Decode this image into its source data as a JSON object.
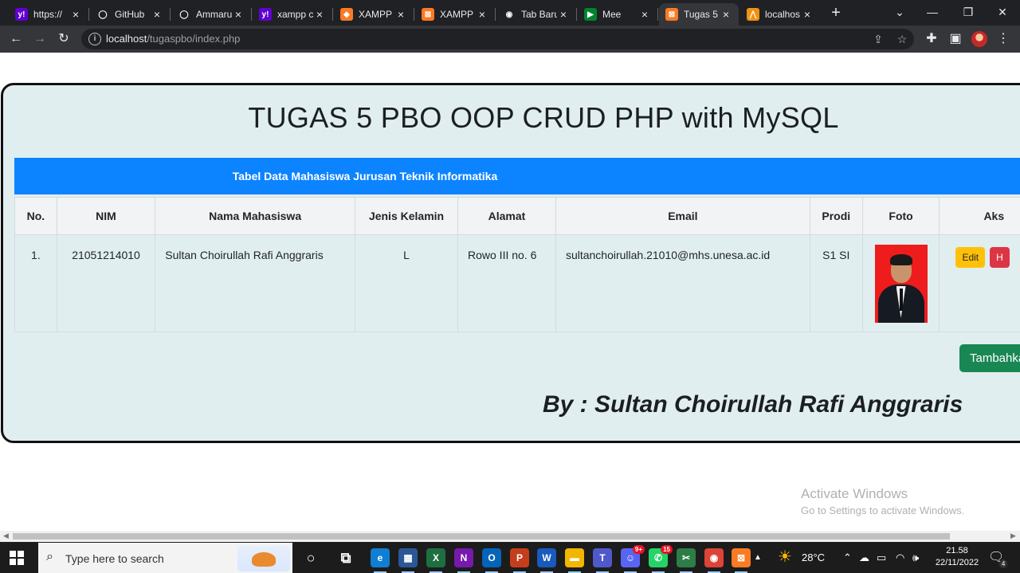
{
  "browser": {
    "tabs": [
      {
        "label": "https://",
        "icon": "yahoo-icon",
        "color": "#6001d2",
        "glyph": "y!"
      },
      {
        "label": "GitHub",
        "icon": "github-icon",
        "color": "#202124",
        "glyph": "◯"
      },
      {
        "label": "Ammaru",
        "icon": "github-icon",
        "color": "#202124",
        "glyph": "◯"
      },
      {
        "label": "xampp c",
        "icon": "yahoo-icon",
        "color": "#6001d2",
        "glyph": "y!"
      },
      {
        "label": "XAMPP",
        "icon": "xampp-diamond-icon",
        "color": "#fb7a24",
        "glyph": "◆"
      },
      {
        "label": "XAMPP I",
        "icon": "xampp-icon",
        "color": "#fb7a24",
        "glyph": "⊠"
      },
      {
        "label": "Tab Baru",
        "icon": "chrome-newtab-icon",
        "color": "#202124",
        "glyph": "◉"
      },
      {
        "label": "Mee",
        "icon": "meet-icon",
        "color": "#00832d",
        "glyph": "▶"
      },
      {
        "label": "Tugas 5",
        "icon": "xampp-icon",
        "color": "#fb7a24",
        "glyph": "⊠",
        "active": true
      },
      {
        "label": "localhos",
        "icon": "phpmyadmin-icon",
        "color": "#f29111",
        "glyph": "⋀"
      }
    ],
    "new_tab_symbol": "+",
    "window_controls": [
      "⌄",
      "—",
      "❐",
      "✕"
    ],
    "url_host": "localhost",
    "url_path": "/tugaspbo/index.php"
  },
  "page": {
    "title": "TUGAS 5 PBO OOP CRUD PHP with MySQL",
    "table_caption": "Tabel Data Mahasiswa Jurusan Teknik Informatika",
    "columns": [
      "No.",
      "NIM",
      "Nama Mahasiswa",
      "Jenis Kelamin",
      "Alamat",
      "Email",
      "Prodi",
      "Foto",
      "Aks"
    ],
    "rows": [
      {
        "no": "1.",
        "nim": "21051214010",
        "nama": "Sultan Choirullah Rafi Anggraris",
        "jk": "L",
        "alamat": "Rowo III no. 6",
        "email": "sultanchoirullah.21010@mhs.unesa.ac.id",
        "prodi": "S1 SI",
        "edit_label": "Edit",
        "delete_label": "H"
      }
    ],
    "add_button": "Tambahka",
    "byline": "By : Sultan Choirullah Rafi Anggraris"
  },
  "watermark": {
    "line1": "Activate Windows",
    "line2": "Go to Settings to activate Windows."
  },
  "taskbar": {
    "search_placeholder": "Type here to search",
    "weather": "28°C",
    "time": "21.58",
    "date": "22/11/2022",
    "notification_count": "4",
    "apps": [
      {
        "name": "cortana-icon",
        "color": "transparent",
        "glyph": "○"
      },
      {
        "name": "task-view-icon",
        "color": "transparent",
        "glyph": "⧉"
      },
      {
        "name": "edge-icon",
        "color": "#0f7fd3",
        "glyph": "e"
      },
      {
        "name": "store-icon",
        "color": "#2b5797",
        "glyph": "▦"
      },
      {
        "name": "excel-icon",
        "color": "#1d6f42",
        "glyph": "X"
      },
      {
        "name": "onenote-icon",
        "color": "#7719aa",
        "glyph": "N"
      },
      {
        "name": "outlook-icon",
        "color": "#0364b8",
        "glyph": "O"
      },
      {
        "name": "powerpoint-icon",
        "color": "#c43e1c",
        "glyph": "P"
      },
      {
        "name": "word-icon",
        "color": "#185abd",
        "glyph": "W"
      },
      {
        "name": "file-explorer-icon",
        "color": "#f2b600",
        "glyph": "▬"
      },
      {
        "name": "teams-icon",
        "color": "#5059c9",
        "glyph": "T"
      },
      {
        "name": "discord-icon",
        "color": "#5865f2",
        "glyph": "☺",
        "badge": "9+"
      },
      {
        "name": "whatsapp-icon",
        "color": "#25d366",
        "glyph": "✆",
        "badge": "15"
      },
      {
        "name": "snipping-icon",
        "color": "#2d7d46",
        "glyph": "✂"
      },
      {
        "name": "chrome-icon",
        "color": "#db4437",
        "glyph": "◉"
      },
      {
        "name": "xampp-icon",
        "color": "#fb7a24",
        "glyph": "⊠"
      }
    ]
  }
}
